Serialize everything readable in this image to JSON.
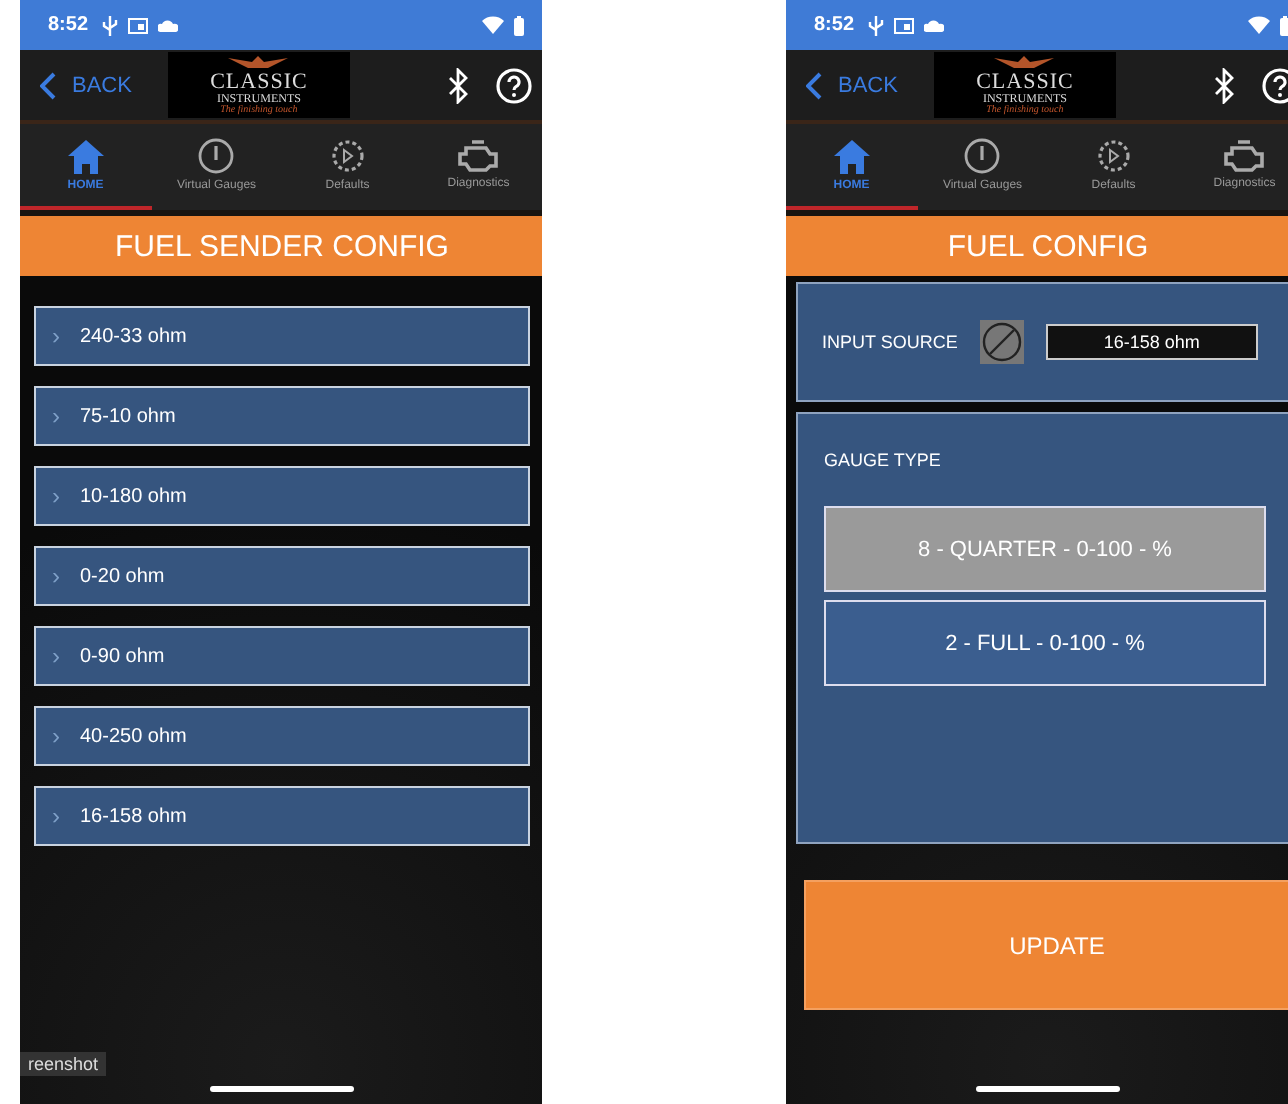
{
  "phones": [
    {
      "kind": "sender_list",
      "status_bar": {
        "time": "8:52"
      },
      "header": {
        "back": "BACK",
        "logo": {
          "line_1": "CLASSIC",
          "line_2": "INSTRUMENTS",
          "tagline": "The finishing touch"
        }
      },
      "tabs": [
        {
          "label": "HOME",
          "selected": true
        },
        {
          "label": "Virtual Gauges",
          "selected": false
        },
        {
          "label": "Defaults",
          "selected": false
        },
        {
          "label": "Diagnostics",
          "selected": false
        }
      ],
      "title": "FUEL SENDER CONFIG",
      "items": [
        {
          "arrow": "›",
          "label": "240-33 ohm"
        },
        {
          "arrow": "›",
          "label": "75-10 ohm"
        },
        {
          "arrow": "›",
          "label": "10-180 ohm"
        },
        {
          "arrow": "›",
          "label": "0-20 ohm"
        },
        {
          "arrow": "›",
          "label": "0-90 ohm"
        },
        {
          "arrow": "›",
          "label": "40-250 ohm"
        },
        {
          "arrow": "›",
          "label": "16-158 ohm"
        }
      ],
      "overlay_label": "reenshot"
    },
    {
      "kind": "config",
      "status_bar": {
        "time": "8:52"
      },
      "header": {
        "back": "BACK",
        "logo": {
          "line_1": "CLASSIC",
          "line_2": "INSTRUMENTS",
          "tagline": "The finishing touch"
        }
      },
      "tabs": [
        {
          "label": "HOME",
          "selected": true
        },
        {
          "label": "Virtual Gauges",
          "selected": false
        },
        {
          "label": "Defaults",
          "selected": false
        },
        {
          "label": "Diagnostics",
          "selected": false
        }
      ],
      "title": "FUEL CONFIG",
      "input_source": {
        "label": "INPUT SOURCE",
        "value": "16-158 ohm"
      },
      "gauge_type": {
        "label": "GAUGE TYPE",
        "options": [
          {
            "label": "8 - QUARTER - 0-100 - %",
            "selected": true
          },
          {
            "label": "2 - FULL - 0-100 - %",
            "selected": false
          }
        ]
      },
      "update_button": "UPDATE"
    }
  ]
}
